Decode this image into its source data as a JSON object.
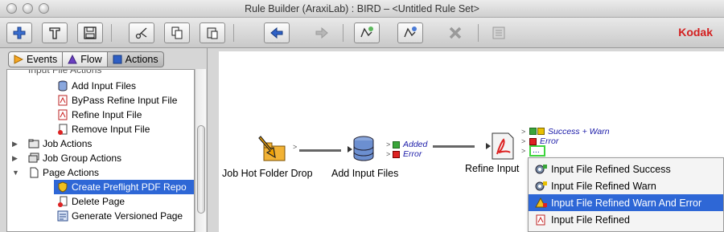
{
  "window": {
    "title": "Rule Builder (AraxiLab) : BIRD – <Untitled Rule Set>"
  },
  "brand": "Kodak",
  "toolbar": {
    "buttons": [
      "add-icon",
      "hammer-icon",
      "save-icon",
      "cut-icon",
      "copy-icon",
      "paste-icon",
      "back-arrow-icon",
      "forward-arrow-icon",
      "add-rule-icon",
      "edit-rule-icon",
      "delete-icon",
      "properties-icon"
    ]
  },
  "tabs": [
    {
      "label": "Events"
    },
    {
      "label": "Flow"
    },
    {
      "label": "Actions",
      "active": true
    }
  ],
  "tree": {
    "items": [
      {
        "label": "Input File Actions"
      },
      {
        "label": "Add Input Files"
      },
      {
        "label": "ByPass Refine Input File"
      },
      {
        "label": "Refine Input File"
      },
      {
        "label": "Remove Input File"
      },
      {
        "label": "Job Actions"
      },
      {
        "label": "Job Group Actions"
      },
      {
        "label": "Page Actions"
      },
      {
        "label": "Create Preflight PDF Repo",
        "selected": true
      },
      {
        "label": "Delete Page"
      },
      {
        "label": "Generate Versioned Page"
      }
    ]
  },
  "canvas": {
    "nodes": [
      {
        "label": "Job Hot Folder Drop"
      },
      {
        "label": "Add Input Files"
      },
      {
        "label": "Refine Input"
      }
    ],
    "add_outputs": [
      "Added",
      "Error"
    ],
    "refine_outputs": [
      "Success + Warn",
      "Error",
      "..."
    ]
  },
  "context_menu": {
    "items": [
      {
        "label": "Input File Refined Success"
      },
      {
        "label": "Input File Refined Warn"
      },
      {
        "label": "Input File Refined Warn And Error",
        "selected": true
      },
      {
        "label": "Input File Refined"
      }
    ]
  }
}
